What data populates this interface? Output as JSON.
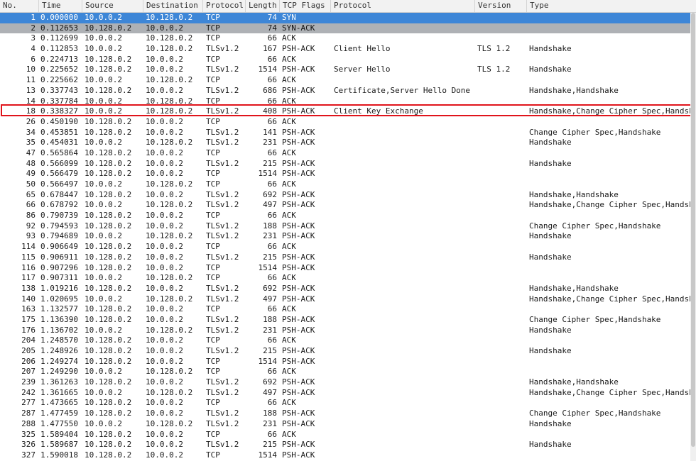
{
  "columns": [
    {
      "id": "no",
      "label": "No."
    },
    {
      "id": "time",
      "label": "Time"
    },
    {
      "id": "src",
      "label": "Source"
    },
    {
      "id": "dst",
      "label": "Destination"
    },
    {
      "id": "proto",
      "label": "Protocol"
    },
    {
      "id": "len",
      "label": "Length"
    },
    {
      "id": "flags",
      "label": "TCP Flags"
    },
    {
      "id": "info",
      "label": "Protocol"
    },
    {
      "id": "ver",
      "label": "Version"
    },
    {
      "id": "type",
      "label": "Type"
    }
  ],
  "colors": {
    "selected": "#3d86d7",
    "secondary": "#aeb1b5",
    "highlight_border": "#e0141b"
  },
  "highlighted_row_no": "18",
  "rows": [
    {
      "no": "1",
      "time": "0.000000",
      "src": "10.0.0.2",
      "dst": "10.128.0.2",
      "proto": "TCP",
      "len": "74",
      "flags": "SYN",
      "info": "",
      "ver": "",
      "type": "",
      "state": "sel"
    },
    {
      "no": "2",
      "time": "0.112653",
      "src": "10.128.0.2",
      "dst": "10.0.0.2",
      "proto": "TCP",
      "len": "74",
      "flags": "SYN-ACK",
      "info": "",
      "ver": "",
      "type": "",
      "state": "sel2"
    },
    {
      "no": "3",
      "time": "0.112699",
      "src": "10.0.0.2",
      "dst": "10.128.0.2",
      "proto": "TCP",
      "len": "66",
      "flags": "ACK",
      "info": "",
      "ver": "",
      "type": ""
    },
    {
      "no": "4",
      "time": "0.112853",
      "src": "10.0.0.2",
      "dst": "10.128.0.2",
      "proto": "TLSv1.2",
      "len": "167",
      "flags": "PSH-ACK",
      "info": "Client Hello",
      "ver": "TLS 1.2",
      "type": "Handshake"
    },
    {
      "no": "6",
      "time": "0.224713",
      "src": "10.128.0.2",
      "dst": "10.0.0.2",
      "proto": "TCP",
      "len": "66",
      "flags": "ACK",
      "info": "",
      "ver": "",
      "type": ""
    },
    {
      "no": "10",
      "time": "0.225652",
      "src": "10.128.0.2",
      "dst": "10.0.0.2",
      "proto": "TLSv1.2",
      "len": "1514",
      "flags": "PSH-ACK",
      "info": "Server Hello",
      "ver": "TLS 1.2",
      "type": "Handshake"
    },
    {
      "no": "11",
      "time": "0.225662",
      "src": "10.0.0.2",
      "dst": "10.128.0.2",
      "proto": "TCP",
      "len": "66",
      "flags": "ACK",
      "info": "",
      "ver": "",
      "type": ""
    },
    {
      "no": "13",
      "time": "0.337743",
      "src": "10.128.0.2",
      "dst": "10.0.0.2",
      "proto": "TLSv1.2",
      "len": "686",
      "flags": "PSH-ACK",
      "info": "Certificate,Server Hello Done",
      "ver": "",
      "type": "Handshake,Handshake"
    },
    {
      "no": "14",
      "time": "0.337784",
      "src": "10.0.0.2",
      "dst": "10.128.0.2",
      "proto": "TCP",
      "len": "66",
      "flags": "ACK",
      "info": "",
      "ver": "",
      "type": ""
    },
    {
      "no": "18",
      "time": "0.338327",
      "src": "10.0.0.2",
      "dst": "10.128.0.2",
      "proto": "TLSv1.2",
      "len": "408",
      "flags": "PSH-ACK",
      "info": "Client Key Exchange",
      "ver": "",
      "type": "Handshake,Change Cipher Spec,Handsh"
    },
    {
      "no": "26",
      "time": "0.450190",
      "src": "10.128.0.2",
      "dst": "10.0.0.2",
      "proto": "TCP",
      "len": "66",
      "flags": "ACK",
      "info": "",
      "ver": "",
      "type": ""
    },
    {
      "no": "34",
      "time": "0.453851",
      "src": "10.128.0.2",
      "dst": "10.0.0.2",
      "proto": "TLSv1.2",
      "len": "141",
      "flags": "PSH-ACK",
      "info": "",
      "ver": "",
      "type": "Change Cipher Spec,Handshake"
    },
    {
      "no": "35",
      "time": "0.454031",
      "src": "10.0.0.2",
      "dst": "10.128.0.2",
      "proto": "TLSv1.2",
      "len": "231",
      "flags": "PSH-ACK",
      "info": "",
      "ver": "",
      "type": "Handshake"
    },
    {
      "no": "47",
      "time": "0.565864",
      "src": "10.128.0.2",
      "dst": "10.0.0.2",
      "proto": "TCP",
      "len": "66",
      "flags": "ACK",
      "info": "",
      "ver": "",
      "type": ""
    },
    {
      "no": "48",
      "time": "0.566099",
      "src": "10.128.0.2",
      "dst": "10.0.0.2",
      "proto": "TLSv1.2",
      "len": "215",
      "flags": "PSH-ACK",
      "info": "",
      "ver": "",
      "type": "Handshake"
    },
    {
      "no": "49",
      "time": "0.566479",
      "src": "10.128.0.2",
      "dst": "10.0.0.2",
      "proto": "TCP",
      "len": "1514",
      "flags": "PSH-ACK",
      "info": "",
      "ver": "",
      "type": ""
    },
    {
      "no": "50",
      "time": "0.566497",
      "src": "10.0.0.2",
      "dst": "10.128.0.2",
      "proto": "TCP",
      "len": "66",
      "flags": "ACK",
      "info": "",
      "ver": "",
      "type": ""
    },
    {
      "no": "65",
      "time": "0.678447",
      "src": "10.128.0.2",
      "dst": "10.0.0.2",
      "proto": "TLSv1.2",
      "len": "692",
      "flags": "PSH-ACK",
      "info": "",
      "ver": "",
      "type": "Handshake,Handshake"
    },
    {
      "no": "66",
      "time": "0.678792",
      "src": "10.0.0.2",
      "dst": "10.128.0.2",
      "proto": "TLSv1.2",
      "len": "497",
      "flags": "PSH-ACK",
      "info": "",
      "ver": "",
      "type": "Handshake,Change Cipher Spec,Handsh"
    },
    {
      "no": "86",
      "time": "0.790739",
      "src": "10.128.0.2",
      "dst": "10.0.0.2",
      "proto": "TCP",
      "len": "66",
      "flags": "ACK",
      "info": "",
      "ver": "",
      "type": ""
    },
    {
      "no": "92",
      "time": "0.794593",
      "src": "10.128.0.2",
      "dst": "10.0.0.2",
      "proto": "TLSv1.2",
      "len": "188",
      "flags": "PSH-ACK",
      "info": "",
      "ver": "",
      "type": "Change Cipher Spec,Handshake"
    },
    {
      "no": "93",
      "time": "0.794689",
      "src": "10.0.0.2",
      "dst": "10.128.0.2",
      "proto": "TLSv1.2",
      "len": "231",
      "flags": "PSH-ACK",
      "info": "",
      "ver": "",
      "type": "Handshake"
    },
    {
      "no": "114",
      "time": "0.906649",
      "src": "10.128.0.2",
      "dst": "10.0.0.2",
      "proto": "TCP",
      "len": "66",
      "flags": "ACK",
      "info": "",
      "ver": "",
      "type": ""
    },
    {
      "no": "115",
      "time": "0.906911",
      "src": "10.128.0.2",
      "dst": "10.0.0.2",
      "proto": "TLSv1.2",
      "len": "215",
      "flags": "PSH-ACK",
      "info": "",
      "ver": "",
      "type": "Handshake"
    },
    {
      "no": "116",
      "time": "0.907296",
      "src": "10.128.0.2",
      "dst": "10.0.0.2",
      "proto": "TCP",
      "len": "1514",
      "flags": "PSH-ACK",
      "info": "",
      "ver": "",
      "type": ""
    },
    {
      "no": "117",
      "time": "0.907311",
      "src": "10.0.0.2",
      "dst": "10.128.0.2",
      "proto": "TCP",
      "len": "66",
      "flags": "ACK",
      "info": "",
      "ver": "",
      "type": ""
    },
    {
      "no": "138",
      "time": "1.019216",
      "src": "10.128.0.2",
      "dst": "10.0.0.2",
      "proto": "TLSv1.2",
      "len": "692",
      "flags": "PSH-ACK",
      "info": "",
      "ver": "",
      "type": "Handshake,Handshake"
    },
    {
      "no": "140",
      "time": "1.020695",
      "src": "10.0.0.2",
      "dst": "10.128.0.2",
      "proto": "TLSv1.2",
      "len": "497",
      "flags": "PSH-ACK",
      "info": "",
      "ver": "",
      "type": "Handshake,Change Cipher Spec,Handsh"
    },
    {
      "no": "163",
      "time": "1.132577",
      "src": "10.128.0.2",
      "dst": "10.0.0.2",
      "proto": "TCP",
      "len": "66",
      "flags": "ACK",
      "info": "",
      "ver": "",
      "type": ""
    },
    {
      "no": "175",
      "time": "1.136390",
      "src": "10.128.0.2",
      "dst": "10.0.0.2",
      "proto": "TLSv1.2",
      "len": "188",
      "flags": "PSH-ACK",
      "info": "",
      "ver": "",
      "type": "Change Cipher Spec,Handshake"
    },
    {
      "no": "176",
      "time": "1.136702",
      "src": "10.0.0.2",
      "dst": "10.128.0.2",
      "proto": "TLSv1.2",
      "len": "231",
      "flags": "PSH-ACK",
      "info": "",
      "ver": "",
      "type": "Handshake"
    },
    {
      "no": "204",
      "time": "1.248570",
      "src": "10.128.0.2",
      "dst": "10.0.0.2",
      "proto": "TCP",
      "len": "66",
      "flags": "ACK",
      "info": "",
      "ver": "",
      "type": ""
    },
    {
      "no": "205",
      "time": "1.248926",
      "src": "10.128.0.2",
      "dst": "10.0.0.2",
      "proto": "TLSv1.2",
      "len": "215",
      "flags": "PSH-ACK",
      "info": "",
      "ver": "",
      "type": "Handshake"
    },
    {
      "no": "206",
      "time": "1.249274",
      "src": "10.128.0.2",
      "dst": "10.0.0.2",
      "proto": "TCP",
      "len": "1514",
      "flags": "PSH-ACK",
      "info": "",
      "ver": "",
      "type": ""
    },
    {
      "no": "207",
      "time": "1.249290",
      "src": "10.0.0.2",
      "dst": "10.128.0.2",
      "proto": "TCP",
      "len": "66",
      "flags": "ACK",
      "info": "",
      "ver": "",
      "type": ""
    },
    {
      "no": "239",
      "time": "1.361263",
      "src": "10.128.0.2",
      "dst": "10.0.0.2",
      "proto": "TLSv1.2",
      "len": "692",
      "flags": "PSH-ACK",
      "info": "",
      "ver": "",
      "type": "Handshake,Handshake"
    },
    {
      "no": "242",
      "time": "1.361665",
      "src": "10.0.0.2",
      "dst": "10.128.0.2",
      "proto": "TLSv1.2",
      "len": "497",
      "flags": "PSH-ACK",
      "info": "",
      "ver": "",
      "type": "Handshake,Change Cipher Spec,Handsh"
    },
    {
      "no": "277",
      "time": "1.473665",
      "src": "10.128.0.2",
      "dst": "10.0.0.2",
      "proto": "TCP",
      "len": "66",
      "flags": "ACK",
      "info": "",
      "ver": "",
      "type": ""
    },
    {
      "no": "287",
      "time": "1.477459",
      "src": "10.128.0.2",
      "dst": "10.0.0.2",
      "proto": "TLSv1.2",
      "len": "188",
      "flags": "PSH-ACK",
      "info": "",
      "ver": "",
      "type": "Change Cipher Spec,Handshake"
    },
    {
      "no": "288",
      "time": "1.477550",
      "src": "10.0.0.2",
      "dst": "10.128.0.2",
      "proto": "TLSv1.2",
      "len": "231",
      "flags": "PSH-ACK",
      "info": "",
      "ver": "",
      "type": "Handshake"
    },
    {
      "no": "325",
      "time": "1.589404",
      "src": "10.128.0.2",
      "dst": "10.0.0.2",
      "proto": "TCP",
      "len": "66",
      "flags": "ACK",
      "info": "",
      "ver": "",
      "type": ""
    },
    {
      "no": "326",
      "time": "1.589687",
      "src": "10.128.0.2",
      "dst": "10.0.0.2",
      "proto": "TLSv1.2",
      "len": "215",
      "flags": "PSH-ACK",
      "info": "",
      "ver": "",
      "type": "Handshake"
    },
    {
      "no": "327",
      "time": "1.590018",
      "src": "10.128.0.2",
      "dst": "10.0.0.2",
      "proto": "TCP",
      "len": "1514",
      "flags": "PSH-ACK",
      "info": "",
      "ver": "",
      "type": ""
    }
  ]
}
